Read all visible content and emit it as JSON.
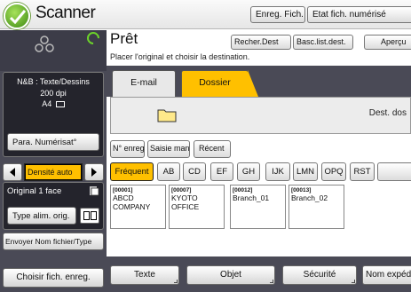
{
  "header": {
    "app_title": "Scanner",
    "btn_send_file": "Enreg. Fich.",
    "btn_file_status": "Etat fich. numérisé"
  },
  "status": {
    "ready": "Prêt",
    "instruction": "Placer l'original et choisir la destination.",
    "ready_color": "#6cd22a"
  },
  "right_buttons": {
    "search_dest": "Recher.Dest",
    "switch_list": "Basc.list.dest.",
    "preview": "Aperçu"
  },
  "left": {
    "scan_mode": "N&B : Texte/Dessins",
    "resolution": "200 dpi",
    "paper": "A4",
    "scan_settings_btn": "Para. Numérisat°",
    "density_label": "Densité auto",
    "original_sides": "Original 1 face",
    "feed_type_btn": "Type alim. orig.",
    "send_filename_btn": "Envoyer Nom fichier/Type",
    "select_stored_btn": "Choisir fich. enreg."
  },
  "tabs": {
    "email": "E-mail",
    "folder": "Dossier"
  },
  "dest_field": {
    "label": "Dest. dos"
  },
  "search_buttons": {
    "reg_no": "N° enreg.",
    "manual_entry": "Saisie man.",
    "recent": "Récent"
  },
  "index": [
    "Fréquent",
    "AB",
    "CD",
    "EF",
    "GH",
    "IJK",
    "LMN",
    "OPQ",
    "RST"
  ],
  "entries": [
    {
      "no": "[00001]",
      "name": "ABCD COMPANY"
    },
    {
      "no": "[00007]",
      "name": "KYOTO OFFICE"
    },
    {
      "no": "[00012]",
      "name": "Branch_01"
    },
    {
      "no": "[00013]",
      "name": "Branch_02"
    }
  ],
  "bottom": {
    "text": "Texte",
    "subject": "Objet",
    "security": "Sécurité",
    "sender_name": "Nom expéd"
  },
  "colors": {
    "accent": "#ffc000",
    "panel": "#4a4a56"
  }
}
